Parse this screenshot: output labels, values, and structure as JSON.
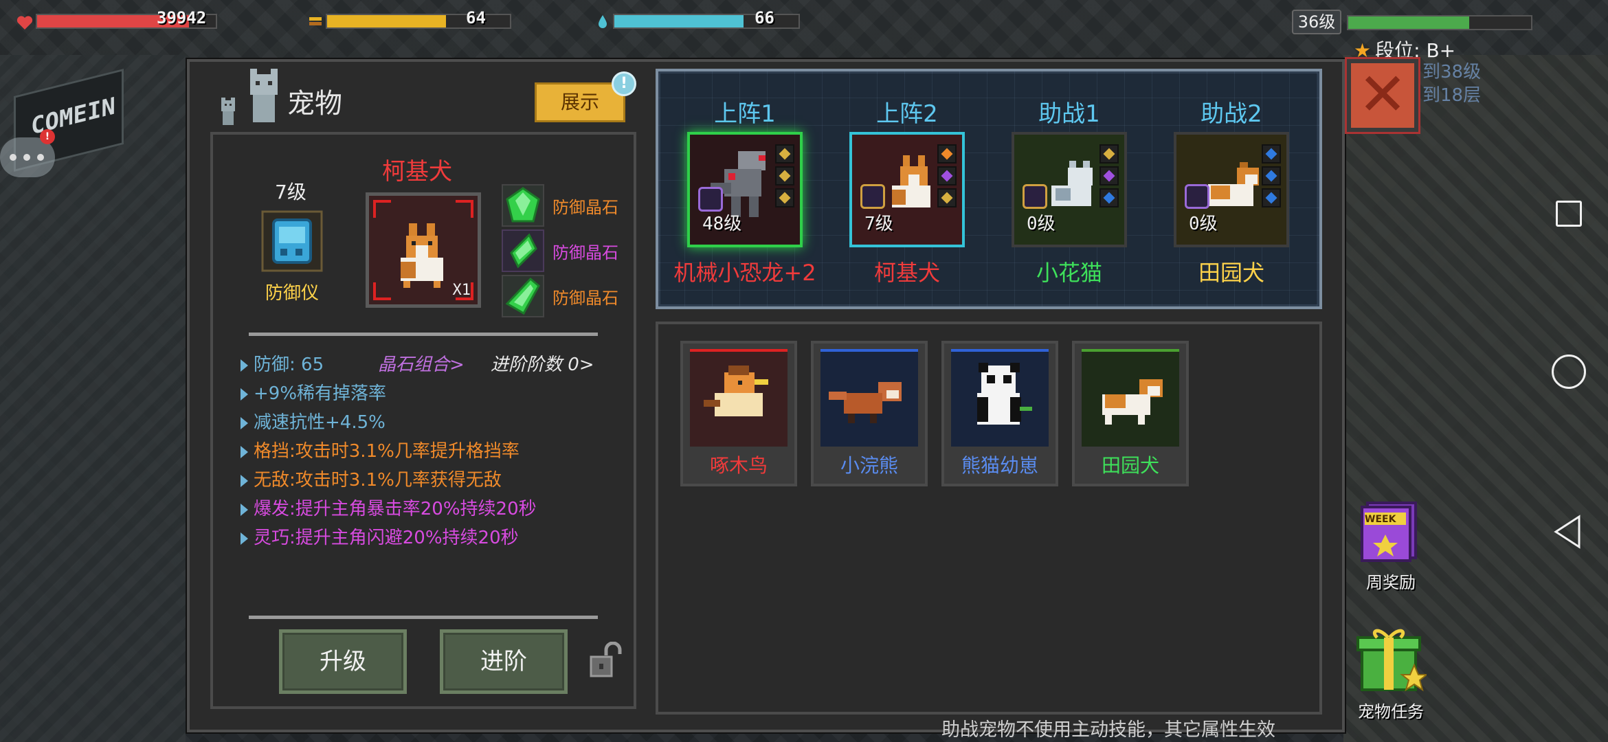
{
  "hud": {
    "hp_value": "39942",
    "food_value": "64",
    "water_value": "66",
    "hp_fill": 0.85,
    "food_fill": 0.65,
    "water_fill": 0.7,
    "player_level": "36级",
    "xp_fill": 0.66,
    "rank": "段位: B+",
    "bg_floor_1": "到38级",
    "bg_floor_2": "到18层",
    "colors": {
      "hp": "#e04545",
      "food": "#e8b324",
      "water": "#4fc2d4",
      "xp": "#4caa4c"
    }
  },
  "background": {
    "sign_text": "COMEIN",
    "chat_badge": "!"
  },
  "header": {
    "title": "宠物",
    "show_button": "展示",
    "info_badge": "!"
  },
  "selected_pet": {
    "name": "柯基犬",
    "level": "7级",
    "device_label": "防御仪",
    "count": "X1",
    "gems": [
      {
        "label": "防御晶石",
        "color": "#f08a2a"
      },
      {
        "label": "防御晶石",
        "color": "#d84be0"
      },
      {
        "label": "防御晶石",
        "color": "#f08a2a"
      }
    ],
    "stats": [
      {
        "text": "防御: 65",
        "color": "#6fb4d8"
      },
      {
        "text": "+9%稀有掉落率",
        "color": "#6fb4d8"
      },
      {
        "text": "减速抗性+4.5%",
        "color": "#6fb4d8"
      },
      {
        "text": "格挡:攻击时3.1%几率提升格挡率",
        "color": "#f08a2a"
      },
      {
        "text": "无敌:攻击时3.1%几率获得无敌",
        "color": "#f08a2a"
      },
      {
        "text": "爆发:提升主角暴击率20%持续20秒",
        "color": "#d84be0"
      },
      {
        "text": "灵巧:提升主角闪避20%持续20秒",
        "color": "#d84be0"
      }
    ],
    "gem_combo": "晶石组合>",
    "advance_count": "进阶阶数 0>",
    "upgrade_button": "升级",
    "advance_button": "进阶"
  },
  "team_slots": [
    {
      "title": "上阵1",
      "name": "机械小恐龙+2",
      "level": "48级",
      "name_color": "#f03b3b",
      "frame": "#2fd04a",
      "bg": "#2a1618"
    },
    {
      "title": "上阵2",
      "name": "柯基犬",
      "level": "7级",
      "name_color": "#f03b3b",
      "frame": "#34c3d8",
      "bg": "#3a1a1c"
    },
    {
      "title": "助战1",
      "name": "小花猫",
      "level": "0级",
      "name_color": "#3ee05a",
      "frame": "#3c3c3c",
      "bg": "#223018"
    },
    {
      "title": "助战2",
      "name": "田园犬",
      "level": "0级",
      "name_color": "#ffd34a",
      "frame": "#3c3c3c",
      "bg": "#2e2a14"
    }
  ],
  "inventory": [
    {
      "name": "啄木鸟",
      "name_color": "#f03b3b",
      "corner": "#d22",
      "bg": "#3a1f20"
    },
    {
      "name": "小浣熊",
      "name_color": "#5a8cf0",
      "corner": "#2f62d8",
      "bg": "#18243c"
    },
    {
      "name": "熊猫幼崽",
      "name_color": "#5a8cf0",
      "corner": "#2f62d8",
      "bg": "#18243c"
    },
    {
      "name": "田园犬",
      "name_color": "#3ee05a",
      "corner": "#4aa030",
      "bg": "#1e2c18"
    }
  ],
  "hint": "助战宠物不使用主动技能，其它属性生效",
  "side": {
    "weekly_reward": "周奖励",
    "week_tag": "WEEK",
    "pet_tasks": "宠物任务"
  }
}
